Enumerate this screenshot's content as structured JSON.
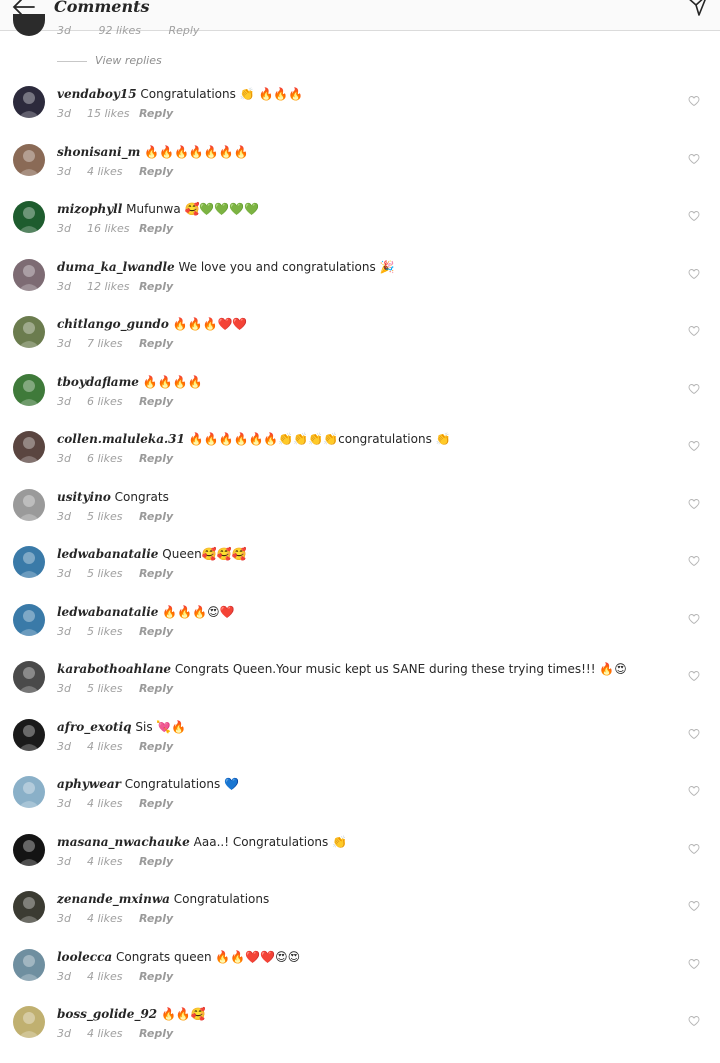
{
  "header": {
    "title": "Comments"
  },
  "partial": {
    "time": "3d",
    "likes": "92 likes",
    "reply": "Reply",
    "view_replies": "View replies"
  },
  "comments": [
    {
      "user": "vendaboy15",
      "text": "Congratulations 👏  🔥🔥🔥",
      "time": "3d",
      "likes": "15 likes",
      "reply": "Reply",
      "avatar": "#2c2a3c"
    },
    {
      "user": "shonisani_m",
      "text": "🔥🔥🔥🔥🔥🔥🔥",
      "time": "3d",
      "likes": "4 likes",
      "reply": "Reply",
      "avatar": "#8a6a56"
    },
    {
      "user": "mizophyll",
      "text": "Mufunwa 🥰💚💚💚💚",
      "time": "3d",
      "likes": "16 likes",
      "reply": "Reply",
      "avatar": "#1e5c2e"
    },
    {
      "user": "duma_ka_lwandle",
      "text": "We love you and congratulations  🎉",
      "time": "3d",
      "likes": "12 likes",
      "reply": "Reply",
      "avatar": "#7d6b73"
    },
    {
      "user": "chitlango_gundo",
      "text": "🔥🔥🔥❤️❤️",
      "time": "3d",
      "likes": "7 likes",
      "reply": "Reply",
      "avatar": "#6b7c4e"
    },
    {
      "user": "tboydaflame",
      "text": "🔥🔥🔥🔥",
      "time": "3d",
      "likes": "6 likes",
      "reply": "Reply",
      "avatar": "#3f7a3a"
    },
    {
      "user": "collen.maluleka.31",
      "text": "🔥🔥🔥🔥🔥🔥👏👏👏👏congratulations 👏",
      "time": "3d",
      "likes": "6 likes",
      "reply": "Reply",
      "avatar": "#5a4540"
    },
    {
      "user": "usityino",
      "text": "Congrats",
      "time": "3d",
      "likes": "5 likes",
      "reply": "Reply",
      "avatar": "#9a9a9a"
    },
    {
      "user": "ledwabanatalie",
      "text": "Queen🥰🥰🥰",
      "time": "3d",
      "likes": "5 likes",
      "reply": "Reply",
      "avatar": "#3a7aa8"
    },
    {
      "user": "ledwabanatalie",
      "text": "🔥🔥🔥😍❤️",
      "time": "3d",
      "likes": "5 likes",
      "reply": "Reply",
      "avatar": "#3a7aa8"
    },
    {
      "user": "karabothoahlane",
      "text": "Congrats Queen.Your music kept us SANE during these trying times!!! 🔥😍",
      "time": "3d",
      "likes": "5 likes",
      "reply": "Reply",
      "avatar": "#4a4a4a"
    },
    {
      "user": "afro_exotiq",
      "text": "Sis 💘🔥",
      "time": "3d",
      "likes": "4 likes",
      "reply": "Reply",
      "avatar": "#1a1a1a"
    },
    {
      "user": "aphywear",
      "text": "Congratulations  💙",
      "time": "3d",
      "likes": "4 likes",
      "reply": "Reply",
      "avatar": "#8ab0c8"
    },
    {
      "user": "masana_nwachauke",
      "text": "Aaa..! Congratulations 👏",
      "time": "3d",
      "likes": "4 likes",
      "reply": "Reply",
      "avatar": "#141414"
    },
    {
      "user": "zenande_mxinwa",
      "text": "Congratulations",
      "time": "3d",
      "likes": "4 likes",
      "reply": "Reply",
      "avatar": "#3b3b32"
    },
    {
      "user": "loolecca",
      "text": "Congrats queen 🔥🔥❤️❤️😍😍",
      "time": "3d",
      "likes": "4 likes",
      "reply": "Reply",
      "avatar": "#6f8fa0"
    },
    {
      "user": "boss_golide_92",
      "text": "🔥🔥🥰",
      "time": "3d",
      "likes": "4 likes",
      "reply": "Reply",
      "avatar": "#c0b070"
    }
  ]
}
